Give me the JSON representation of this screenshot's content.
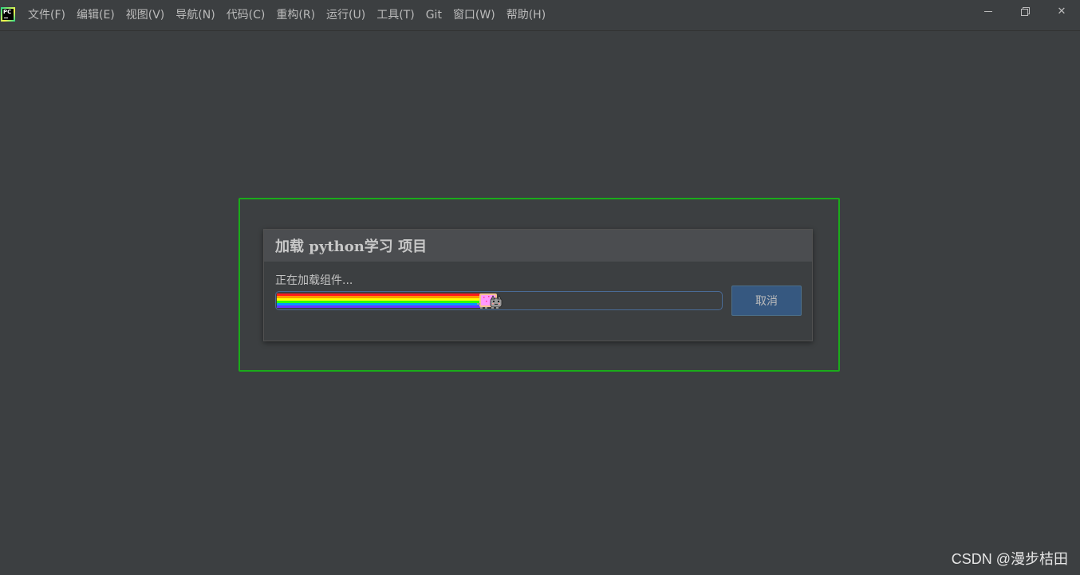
{
  "app": {
    "logo_icon": "pycharm-icon",
    "logo_text": "PC"
  },
  "menu": [
    {
      "label": "文件(F)"
    },
    {
      "label": "编辑(E)"
    },
    {
      "label": "视图(V)"
    },
    {
      "label": "导航(N)"
    },
    {
      "label": "代码(C)"
    },
    {
      "label": "重构(R)"
    },
    {
      "label": "运行(U)"
    },
    {
      "label": "工具(T)"
    },
    {
      "label": "Git"
    },
    {
      "label": "窗口(W)"
    },
    {
      "label": "帮助(H)"
    }
  ],
  "window_controls": {
    "minimize_icon": "minimize-icon",
    "restore_icon": "restore-icon",
    "close_icon": "close-icon",
    "close_glyph": "✕"
  },
  "dialog": {
    "title": "加载 python学习 项目",
    "status": "正在加载组件...",
    "progress": 0.46,
    "cancel_label": "取消"
  },
  "watermark": "CSDN @漫步桔田",
  "colors": {
    "background": "#3c3f41",
    "dialog_header": "#4b4d50",
    "button": "#365880",
    "highlight_frame": "#1aab1a",
    "progress_border": "#4a6b96"
  }
}
